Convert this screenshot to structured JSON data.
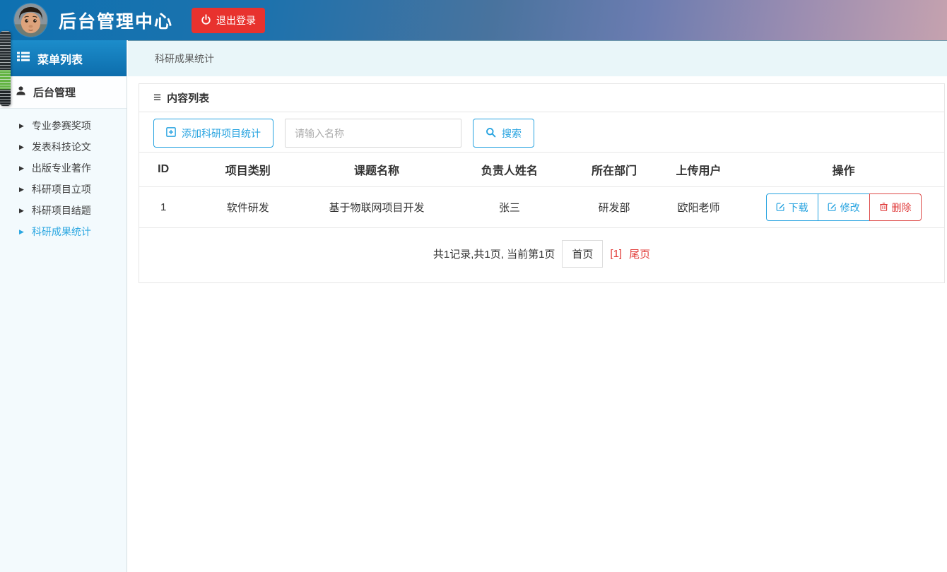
{
  "header": {
    "title": "后台管理中心",
    "logout_label": "退出登录"
  },
  "sidebar": {
    "menu_header": "菜单列表",
    "section_label": "后台管理",
    "items": [
      {
        "label": "专业参赛奖项"
      },
      {
        "label": "发表科技论文"
      },
      {
        "label": "出版专业著作"
      },
      {
        "label": "科研项目立项"
      },
      {
        "label": "科研项目结题"
      },
      {
        "label": "科研成果统计"
      }
    ],
    "active_item": "科研成果统计"
  },
  "breadcrumb": {
    "current": "科研成果统计"
  },
  "content": {
    "panel_title": "内容列表",
    "toolbar": {
      "add_button": "添加科研项目统计",
      "search_placeholder": "请输入名称",
      "search_button": "搜索"
    },
    "table": {
      "columns": [
        "ID",
        "项目类别",
        "课题名称",
        "负责人姓名",
        "所在部门",
        "上传用户",
        "操作"
      ],
      "rows": [
        {
          "id": "1",
          "category": "软件研发",
          "topic": "基于物联网项目开发",
          "leader": "张三",
          "department": "研发部",
          "uploader": "欧阳老师",
          "actions": {
            "download": "下载",
            "edit": "修改",
            "delete": "删除"
          }
        }
      ]
    },
    "pagination": {
      "summary": "共1记录,共1页, 当前第1页",
      "first_page": "首页",
      "current_page": "[1]",
      "last_page": "尾页"
    }
  },
  "colors": {
    "accent_blue": "#27a3e0",
    "danger_red": "#e8322e",
    "link_red": "#e23c38",
    "sidebar_header_blue": "#0d6dac"
  }
}
